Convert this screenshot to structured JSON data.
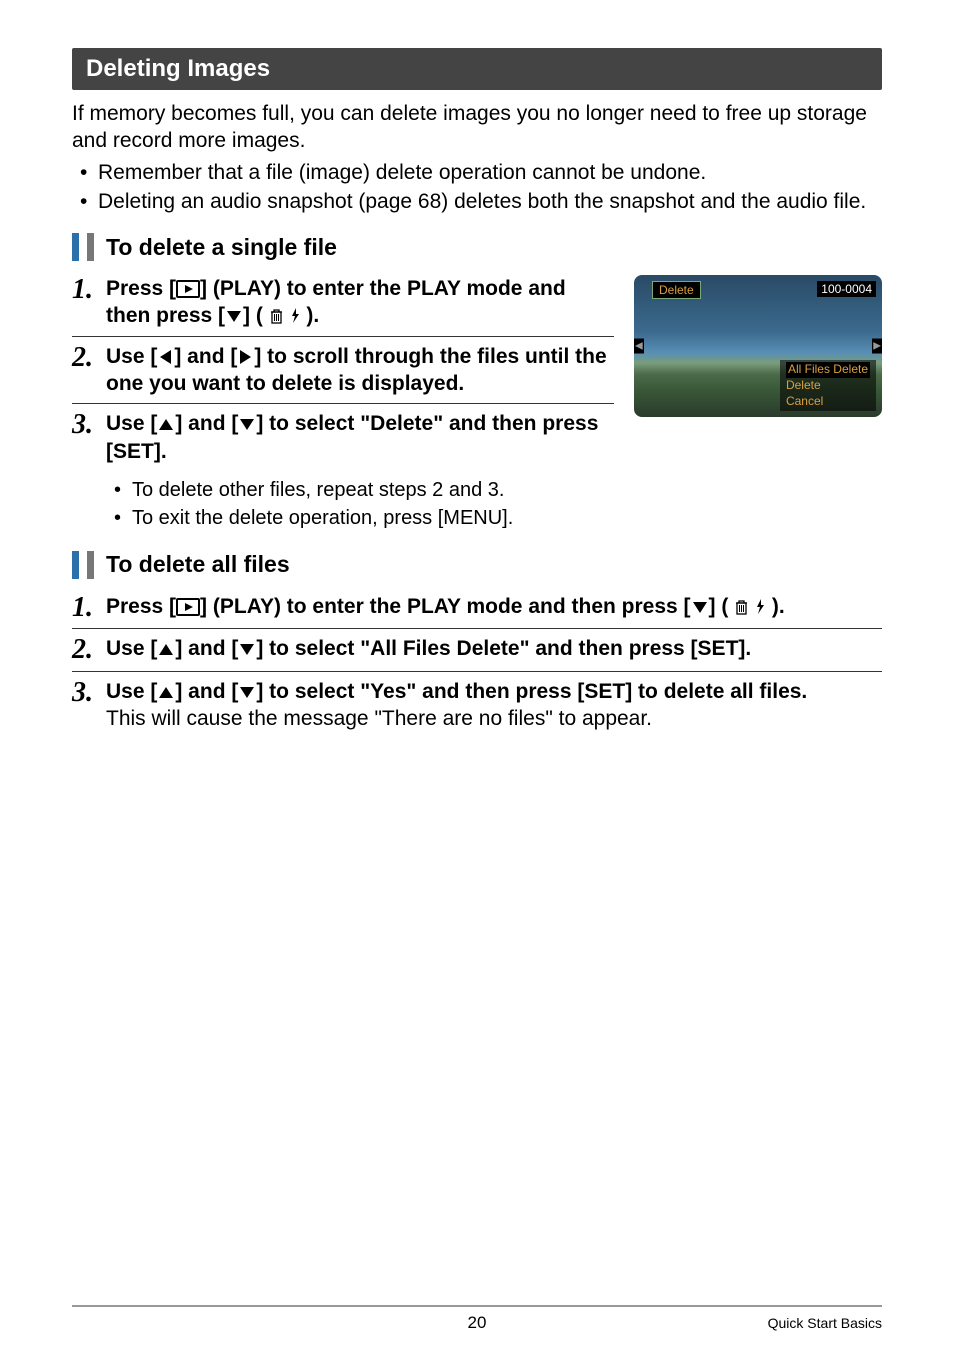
{
  "section_title": "Deleting Images",
  "intro": "If memory becomes full, you can delete images you no longer need to free up storage and record more images.",
  "intro_bullets": [
    "Remember that a file (image) delete operation cannot be undone.",
    "Deleting an audio snapshot (page 68) deletes both the snapshot and the audio file."
  ],
  "sub1_title": "To delete a single file",
  "sub1_steps": {
    "s1a": "Press [",
    "s1b": "] (PLAY) to enter the PLAY mode and then press [",
    "s1c": "] ( ",
    "s1d": " ).",
    "s2a": "Use [",
    "s2b": "] and [",
    "s2c": "] to scroll through the files until the one you want to delete is displayed.",
    "s3a": "Use [",
    "s3b": "] and [",
    "s3c": "] to select \"Delete\" and then press [SET].",
    "s3_bullets": [
      "To delete other files, repeat steps 2 and 3.",
      "To exit the delete operation, press [MENU]."
    ]
  },
  "sub2_title": "To delete all files",
  "sub2_steps": {
    "s1a": "Press [",
    "s1b": "] (PLAY) to enter the PLAY mode and then press [",
    "s1c": "] ( ",
    "s1d": " ).",
    "s2a": "Use [",
    "s2b": "] and [",
    "s2c": "] to select \"All Files Delete\" and then press [SET].",
    "s3a": "Use [",
    "s3b": "] and [",
    "s3c": "] to select \"Yes\" and then press [SET] to delete all files.",
    "s3_body": "This will cause the message \"There are no files\" to appear."
  },
  "camera": {
    "delete_label": "Delete",
    "image_id": "100-0004",
    "menu": {
      "all_files": "All Files Delete",
      "delete": "Delete",
      "cancel": "Cancel"
    }
  },
  "footer": {
    "page": "20",
    "chapter": "Quick Start Basics"
  }
}
